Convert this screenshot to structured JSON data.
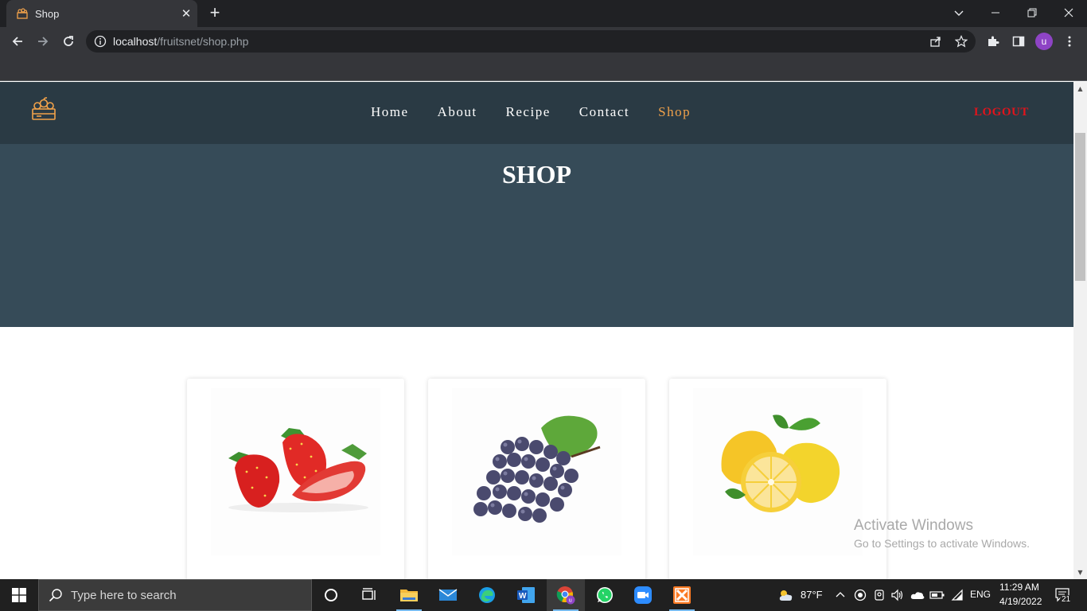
{
  "browser": {
    "tab_title": "Shop",
    "url_host": "localhost",
    "url_path": "/fruitsnet/shop.php",
    "profile_initial": "u"
  },
  "site": {
    "nav": [
      {
        "label": "Home"
      },
      {
        "label": "About"
      },
      {
        "label": "Recipe"
      },
      {
        "label": "Contact"
      },
      {
        "label": "Shop",
        "active": true
      }
    ],
    "logout_label": "LOGOUT",
    "hero_title": "SHOP",
    "products": [
      {
        "image": "strawberry"
      },
      {
        "image": "grapes"
      },
      {
        "image": "lemon"
      }
    ],
    "colors": {
      "header_bg": "#2a3a44",
      "hero_bg": "#364b58",
      "accent": "#f2a24a",
      "logout": "#e0141c"
    }
  },
  "watermark": {
    "title": "Activate Windows",
    "subtitle": "Go to Settings to activate Windows."
  },
  "taskbar": {
    "search_placeholder": "Type here to search",
    "weather": "87°F",
    "language": "ENG",
    "time": "11:29 AM",
    "date": "4/19/2022",
    "notification_count": "21"
  }
}
